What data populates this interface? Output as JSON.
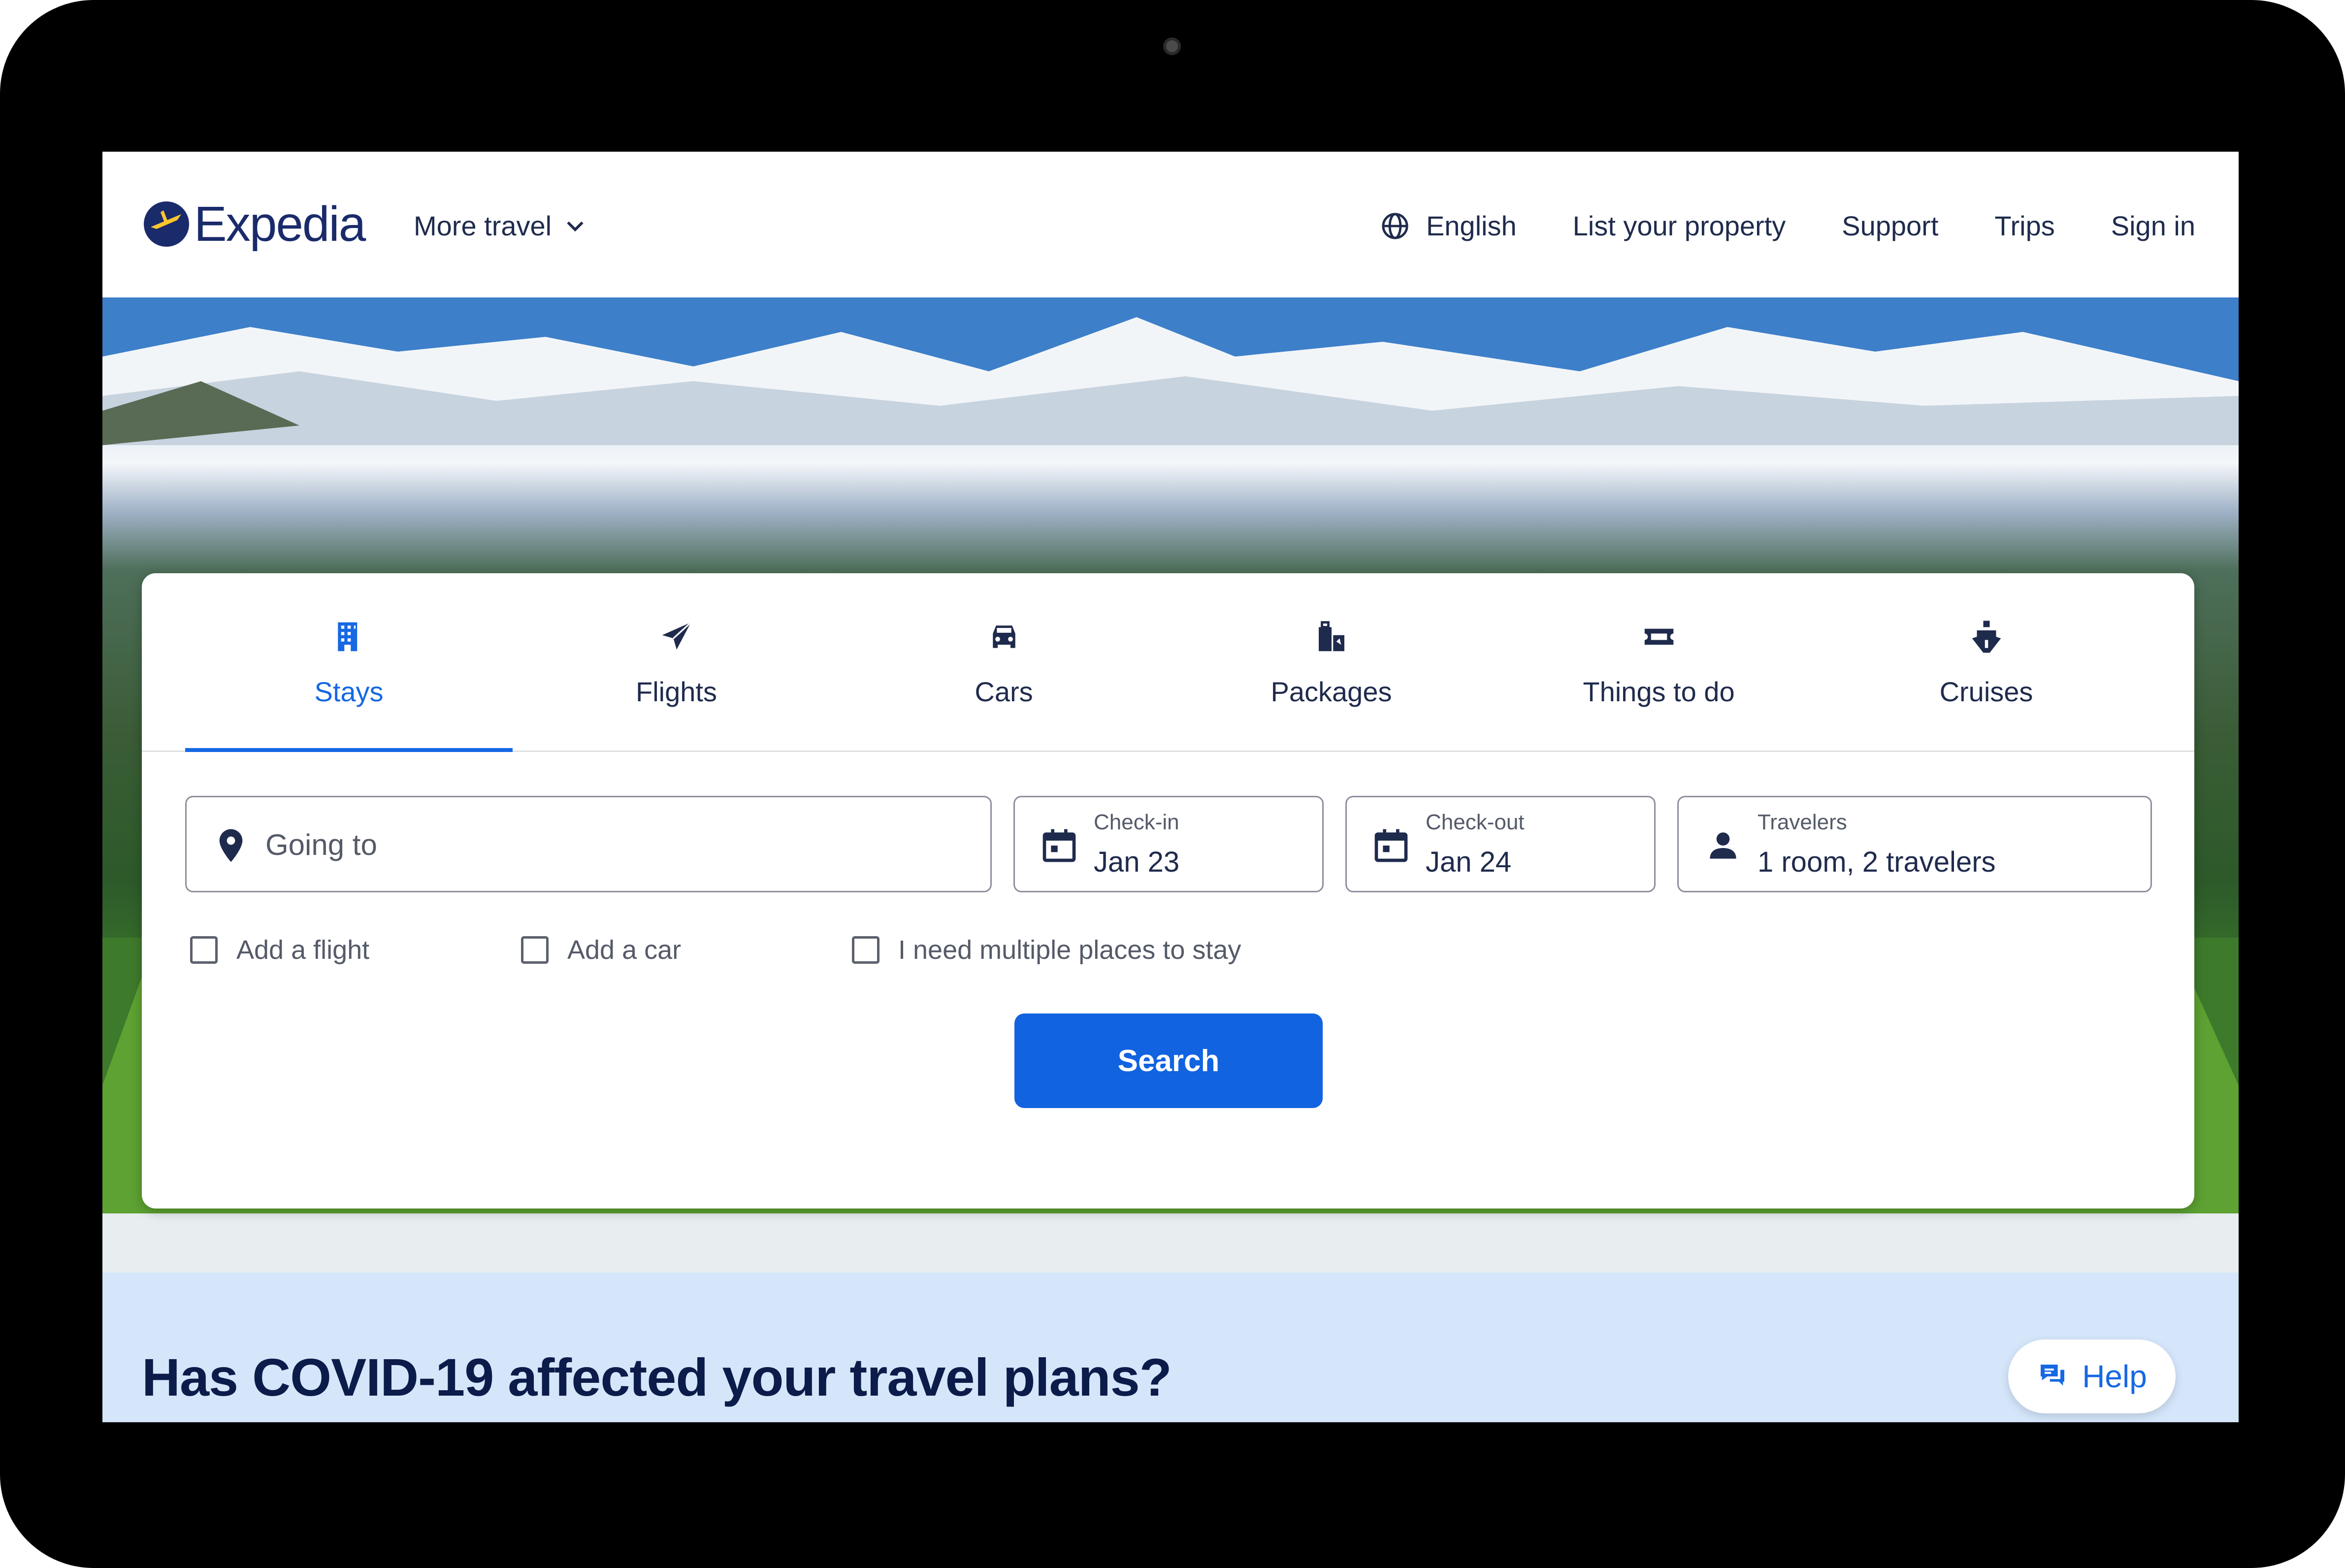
{
  "header": {
    "brand": "Expedia",
    "more_travel": "More travel",
    "nav": [
      "English",
      "List your property",
      "Support",
      "Trips",
      "Sign in"
    ]
  },
  "tabs": [
    {
      "label": "Stays",
      "icon": "building-icon",
      "active": true
    },
    {
      "label": "Flights",
      "icon": "plane-icon",
      "active": false
    },
    {
      "label": "Cars",
      "icon": "car-icon",
      "active": false
    },
    {
      "label": "Packages",
      "icon": "packages-icon",
      "active": false
    },
    {
      "label": "Things to do",
      "icon": "ticket-icon",
      "active": false
    },
    {
      "label": "Cruises",
      "icon": "cruise-ship-icon",
      "active": false
    }
  ],
  "search": {
    "going_to_placeholder": "Going to",
    "checkin_label": "Check-in",
    "checkin_value": "Jan 23",
    "checkout_label": "Check-out",
    "checkout_value": "Jan 24",
    "travelers_label": "Travelers",
    "travelers_value": "1 room, 2 travelers",
    "options": [
      "Add a flight",
      "Add a car",
      "I need multiple places to stay"
    ],
    "button": "Search"
  },
  "banner": {
    "title": "Has COVID-19 affected your travel plans?",
    "help": "Help"
  },
  "colors": {
    "accent": "#1668e3",
    "button": "#1163e0",
    "text": "#1f2b4d",
    "banner_bg": "#d5e6fb"
  }
}
